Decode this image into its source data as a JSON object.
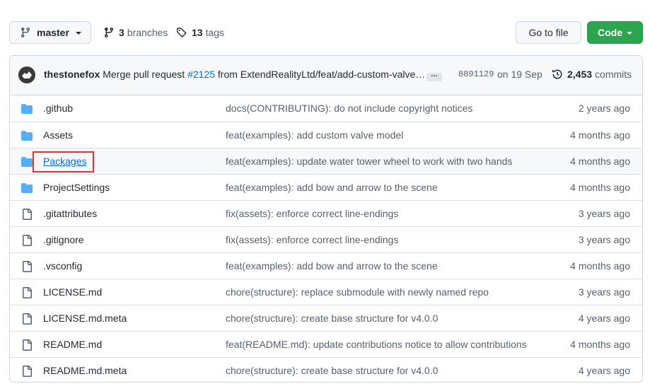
{
  "toolbar": {
    "branch_label": "master",
    "branches_count": "3",
    "branches_label": "branches",
    "tags_count": "13",
    "tags_label": "tags",
    "go_to_file_label": "Go to file",
    "code_label": "Code"
  },
  "commit": {
    "author": "thestonefox",
    "message_prefix": "Merge pull request",
    "pr_number": "#2125",
    "message_suffix": "from ExtendRealityLtd/feat/add-custom-valve…",
    "ellipsis": "…",
    "sha": "8891129",
    "date": "on 19 Sep",
    "commit_count": "2,453",
    "commits_label": "commits"
  },
  "files": [
    {
      "type": "folder",
      "name": ".github",
      "message": "docs(CONTRIBUTING): do not include copyright notices",
      "age": "2 years ago"
    },
    {
      "type": "folder",
      "name": "Assets",
      "message": "feat(examples): add custom valve model",
      "age": "4 months ago"
    },
    {
      "type": "folder",
      "name": "Packages",
      "message": "feat(examples): update water tower wheel to work with two hands",
      "age": "4 months ago"
    },
    {
      "type": "folder",
      "name": "ProjectSettings",
      "message": "feat(examples): add bow and arrow to the scene",
      "age": "4 months ago"
    },
    {
      "type": "file",
      "name": ".gitattributes",
      "message": "fix(assets): enforce correct line-endings",
      "age": "3 years ago"
    },
    {
      "type": "file",
      "name": ".gitignore",
      "message": "fix(assets): enforce correct line-endings",
      "age": "3 years ago"
    },
    {
      "type": "file",
      "name": ".vsconfig",
      "message": "feat(examples): add bow and arrow to the scene",
      "age": "4 months ago"
    },
    {
      "type": "file",
      "name": "LICENSE.md",
      "message": "chore(structure): replace submodule with newly named repo",
      "age": "3 years ago"
    },
    {
      "type": "file",
      "name": "LICENSE.md.meta",
      "message": "chore(structure): create base structure for v4.0.0",
      "age": "4 years ago"
    },
    {
      "type": "file",
      "name": "README.md",
      "message": "feat(README.md): update contributions notice to allow contributions",
      "age": "4 months ago"
    },
    {
      "type": "file",
      "name": "README.md.meta",
      "message": "chore(structure): create base structure for v4.0.0",
      "age": "4 years ago"
    }
  ],
  "colors": {
    "folder": "#54aeff",
    "file": "#57606a",
    "link": "#0969da",
    "code_button": "#2da44e",
    "highlight": "#e03131"
  },
  "icons": {
    "branch": "git-branch-icon",
    "tag": "tag-icon",
    "history": "history-icon",
    "folder": "folder-icon",
    "file": "file-icon"
  }
}
